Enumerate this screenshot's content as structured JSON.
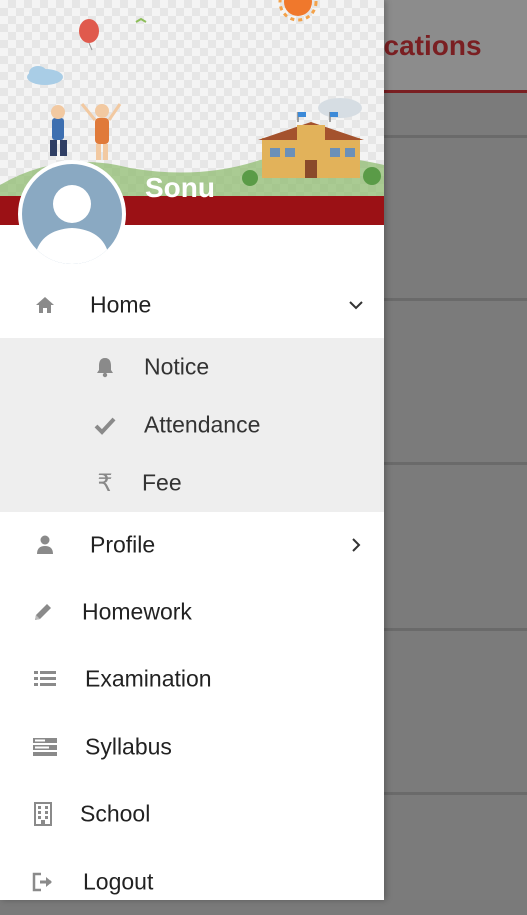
{
  "background_app": {
    "title_fragment": "Notifications"
  },
  "drawer": {
    "user_name": "Sonu",
    "menu": [
      {
        "label": "Home",
        "icon": "home-icon",
        "expanded": true
      },
      {
        "label": "Profile",
        "icon": "user-icon"
      },
      {
        "label": "Homework",
        "icon": "pencil-icon"
      },
      {
        "label": "Examination",
        "icon": "list-icon"
      },
      {
        "label": "Syllabus",
        "icon": "syllabus-icon"
      },
      {
        "label": "School",
        "icon": "building-icon"
      },
      {
        "label": "Logout",
        "icon": "logout-icon"
      }
    ],
    "home_submenu": [
      {
        "label": "Notice",
        "icon": "bell-icon"
      },
      {
        "label": "Attendance",
        "icon": "check-icon"
      },
      {
        "label": "Fee",
        "icon": "rupee-icon"
      }
    ]
  },
  "colors": {
    "brand_red": "#9b1115",
    "overlay": "#7b7b7b",
    "submenu_bg": "#eeeeee"
  }
}
